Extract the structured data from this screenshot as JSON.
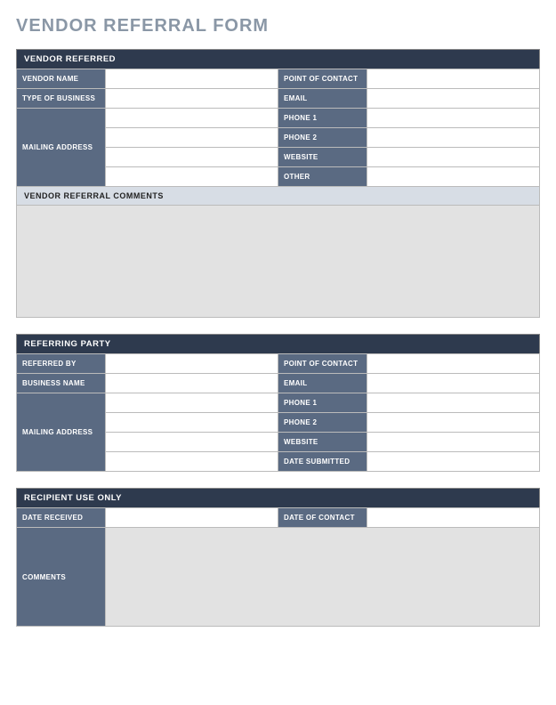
{
  "title": "VENDOR REFERRAL FORM",
  "vendor": {
    "header": "VENDOR REFERRED",
    "labels": {
      "vendor_name": "VENDOR NAME",
      "point_of_contact": "POINT OF CONTACT",
      "type_of_business": "TYPE OF BUSINESS",
      "email": "EMAIL",
      "mailing_address": "MAILING ADDRESS",
      "phone1": "PHONE 1",
      "phone2": "PHONE 2",
      "website": "WEBSITE",
      "other": "OTHER",
      "comments": "VENDOR REFERRAL COMMENTS"
    },
    "values": {
      "vendor_name": "",
      "point_of_contact": "",
      "type_of_business": "",
      "email": "",
      "mailing_address_1": "",
      "mailing_address_2": "",
      "mailing_address_3": "",
      "mailing_address_4": "",
      "phone1": "",
      "phone2": "",
      "website": "",
      "other": "",
      "comments": ""
    }
  },
  "referring": {
    "header": "REFERRING PARTY",
    "labels": {
      "referred_by": "REFERRED BY",
      "point_of_contact": "POINT OF CONTACT",
      "business_name": "BUSINESS NAME",
      "email": "EMAIL",
      "mailing_address": "MAILING ADDRESS",
      "phone1": "PHONE 1",
      "phone2": "PHONE 2",
      "website": "WEBSITE",
      "date_submitted": "DATE SUBMITTED"
    },
    "values": {
      "referred_by": "",
      "point_of_contact": "",
      "business_name": "",
      "email": "",
      "mailing_address_1": "",
      "mailing_address_2": "",
      "mailing_address_3": "",
      "mailing_address_4": "",
      "phone1": "",
      "phone2": "",
      "website": "",
      "date_submitted": ""
    }
  },
  "recipient": {
    "header": "RECIPIENT USE ONLY",
    "labels": {
      "date_received": "DATE RECEIVED",
      "date_of_contact": "DATE OF CONTACT",
      "comments": "COMMENTS"
    },
    "values": {
      "date_received": "",
      "date_of_contact": "",
      "comments": ""
    }
  }
}
